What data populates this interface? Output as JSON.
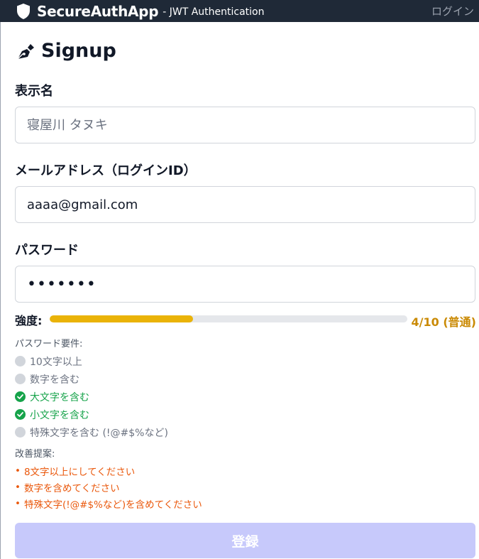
{
  "navbar": {
    "brand_name": "SecureAuthApp",
    "brand_sub": "- JWT Authentication",
    "brand_icon": "shield-icon",
    "login_link": "ログイン"
  },
  "page": {
    "title": "Signup",
    "title_icon": "pen-nib-icon"
  },
  "form": {
    "display_name": {
      "label": "表示名",
      "value": "",
      "placeholder": "寝屋川 タヌキ"
    },
    "email": {
      "label": "メールアドレス（ログインID）",
      "value": "aaaa@gmail.com",
      "placeholder": ""
    },
    "password": {
      "label": "パスワード",
      "value": "•••••••"
    },
    "strength": {
      "label": "強度:",
      "score": 4,
      "max": 10,
      "text": "4/10 (普通)",
      "fill_fraction": 0.4,
      "color": "#eab308"
    },
    "requirements": {
      "title": "パスワード要件:",
      "items": [
        {
          "text": "10文字以上",
          "met": false
        },
        {
          "text": "数字を含む",
          "met": false
        },
        {
          "text": "大文字を含む",
          "met": true
        },
        {
          "text": "小文字を含む",
          "met": true
        },
        {
          "text": "特殊文字を含む (!@#$%など)",
          "met": false
        }
      ]
    },
    "suggestions": {
      "title": "改善提案:",
      "bullet": "•",
      "items": [
        "8文字以上にしてください",
        "数字を含めてください",
        "特殊文字(!@#$%など)を含めてください"
      ]
    },
    "submit_label": "登録"
  },
  "colors": {
    "navbar_bg": "#1f2937",
    "met": "#16a34a",
    "unmet": "#d1d5db",
    "suggestion": "#ea580c",
    "submit_disabled": "#c7c9fb"
  }
}
